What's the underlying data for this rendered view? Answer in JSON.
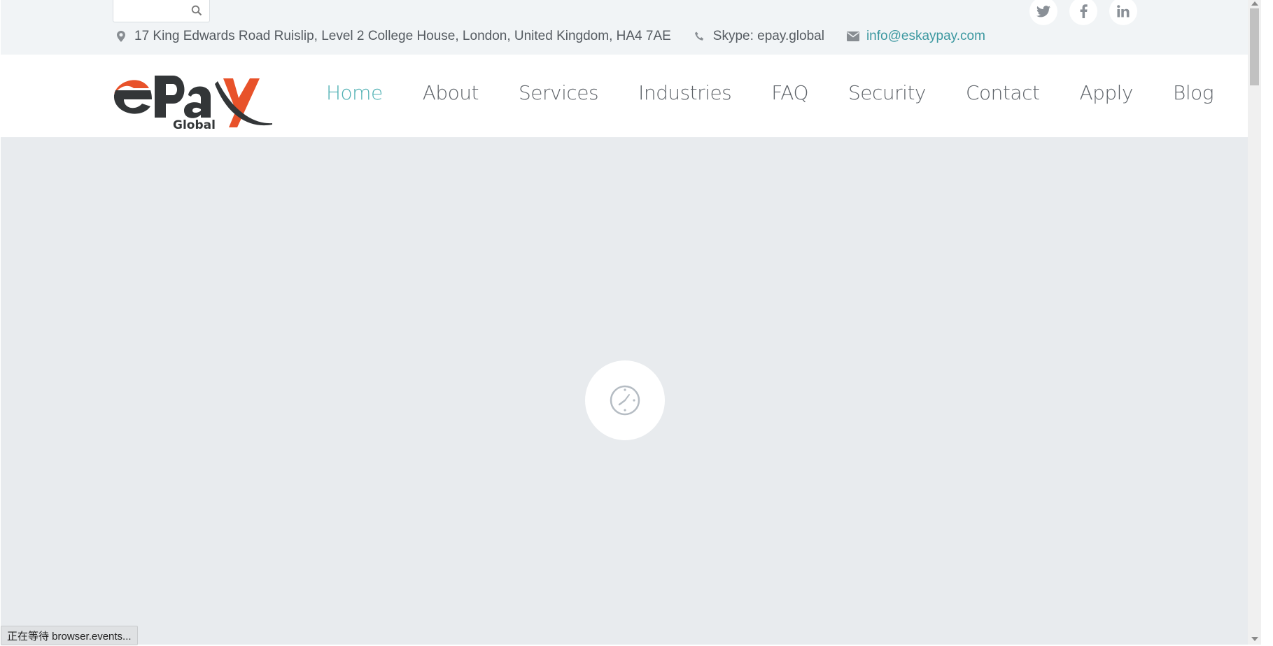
{
  "topbar": {
    "address": "17 King Edwards Road Ruislip, Level 2 College House, London, United Kingdom, HA4 7AE",
    "skype": "Skype: epay.global",
    "email": "info@eskaypay.com",
    "socials": [
      {
        "name": "twitter-icon",
        "glyph": "t"
      },
      {
        "name": "facebook-icon",
        "glyph": "f"
      },
      {
        "name": "linkedin-icon",
        "glyph": "in"
      }
    ]
  },
  "logo": {
    "text_main": "ePay",
    "text_sub": "Global",
    "colors": {
      "dark": "#333638",
      "accent": "#e8522a"
    }
  },
  "nav": {
    "items": [
      {
        "label": "Home",
        "active": true
      },
      {
        "label": "About",
        "active": false
      },
      {
        "label": "Services",
        "active": false
      },
      {
        "label": "Industries",
        "active": false
      },
      {
        "label": "FAQ",
        "active": false
      },
      {
        "label": "Security",
        "active": false
      },
      {
        "label": "Contact",
        "active": false
      },
      {
        "label": "Apply",
        "active": false
      },
      {
        "label": "Blog",
        "active": false
      }
    ]
  },
  "status_bar": {
    "text": "正在等待 browser.events..."
  },
  "colors": {
    "accent": "#4fb0b3",
    "link": "#3c98a0",
    "background": "#e8ebee"
  }
}
